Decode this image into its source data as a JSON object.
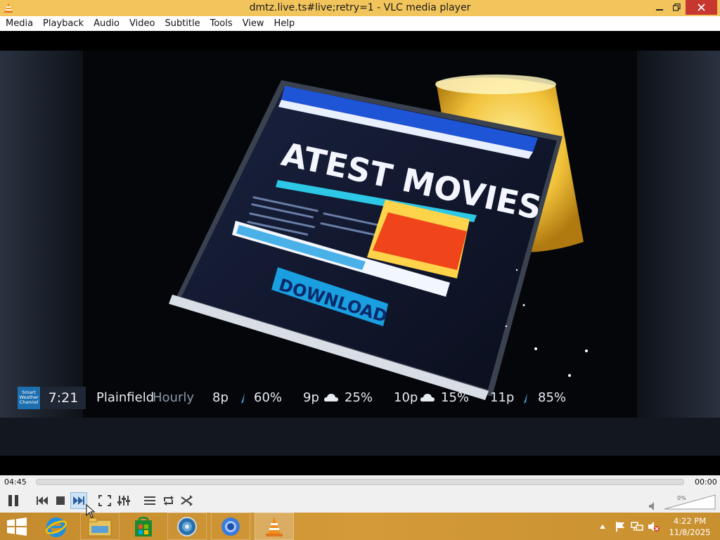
{
  "window": {
    "title": "dmtz.live.ts#live;retry=1 - VLC media player"
  },
  "menu": {
    "items": [
      "Media",
      "Playback",
      "Audio",
      "Video",
      "Subtitle",
      "Tools",
      "View",
      "Help"
    ]
  },
  "video": {
    "screen_text": "ATEST MOVIES",
    "download_text": "DOWNLOAD"
  },
  "weather": {
    "logo_text": "Smart Weather Channel",
    "time": "7:21",
    "city": "Plainfield",
    "mode": "Hourly",
    "forecast": [
      {
        "hour": "8p",
        "icon": "rain-icon",
        "pct": "60%"
      },
      {
        "hour": "9p",
        "icon": "cloud-icon",
        "pct": "25%"
      },
      {
        "hour": "10p",
        "icon": "cloud-icon",
        "pct": "15%"
      },
      {
        "hour": "11p",
        "icon": "rain-icon",
        "pct": "85%"
      }
    ]
  },
  "player": {
    "elapsed": "04:45",
    "remaining": "00:00",
    "seek_progress": 0,
    "volume": "0%",
    "volume_level": 0
  },
  "taskbar": {
    "time": "4:22 PM",
    "date": "11/8/2025"
  },
  "colors": {
    "titlebar": "#f2c55c",
    "close": "#c7372f",
    "taskbar": "#d49a38"
  }
}
